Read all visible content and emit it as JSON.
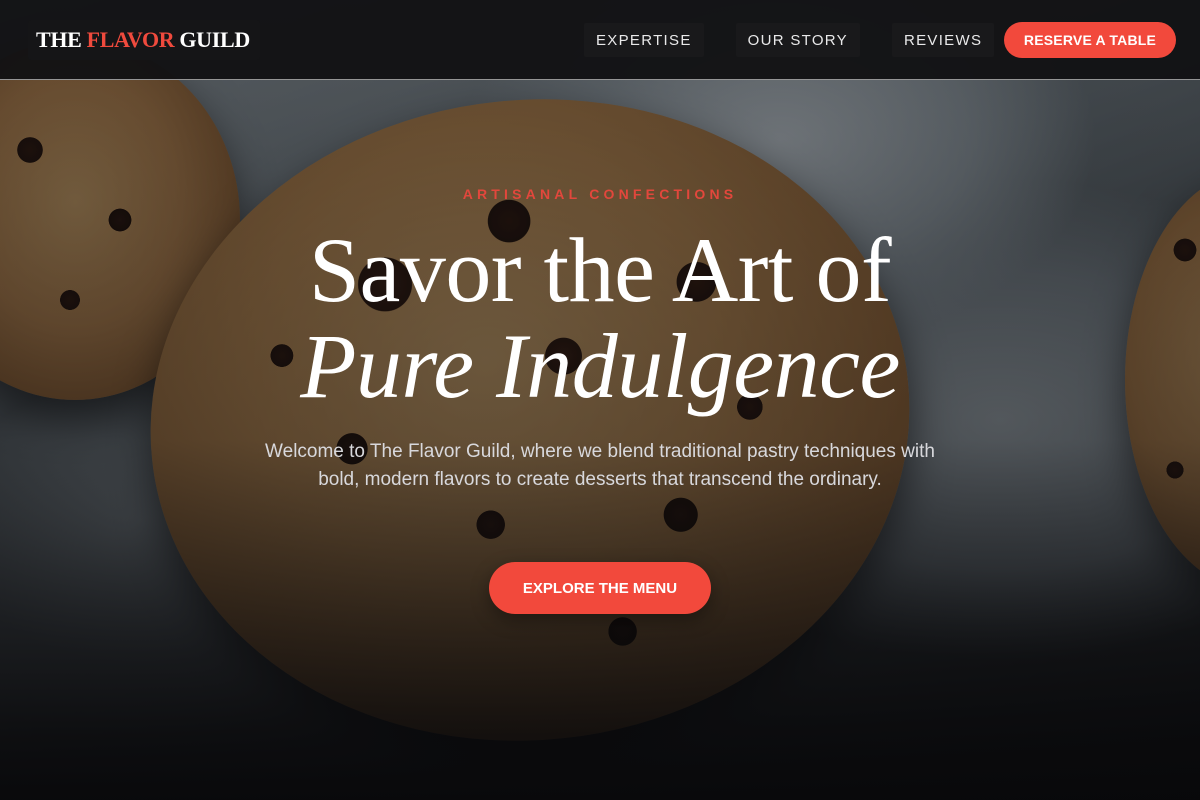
{
  "brand": {
    "name_part1": "THE",
    "name_accent": "FLAVOR",
    "name_part2": "GUILD",
    "accent_color": "#ef4a3d"
  },
  "nav": {
    "links": [
      {
        "label": "EXPERTISE"
      },
      {
        "label": "OUR STORY"
      },
      {
        "label": "REVIEWS"
      }
    ],
    "cta_label": "RESERVE A TABLE"
  },
  "hero": {
    "eyebrow": "ARTISANAL CONFECTIONS",
    "headline_line1": "Savor the Art of",
    "headline_line2": "Pure Indulgence",
    "subtitle": "Welcome to The Flavor Guild, where we blend traditional pastry techniques with bold, modern flavors to create desserts that transcend the ordinary.",
    "cta_label": "EXPLORE THE MENU"
  },
  "colors": {
    "accent": "#f2493c",
    "nav_background": "#121214",
    "text_primary": "#ffffff"
  }
}
